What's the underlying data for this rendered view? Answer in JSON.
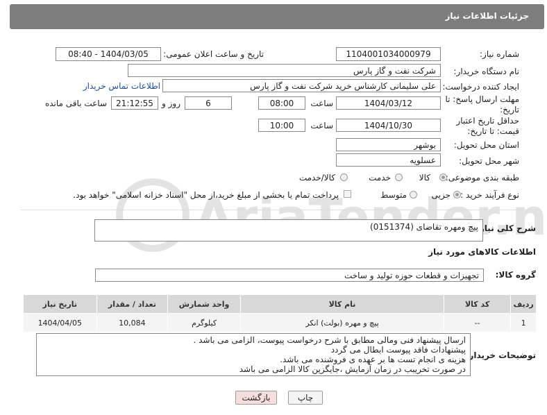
{
  "header": {
    "title": "جزئیات اطلاعات نیاز"
  },
  "fields": {
    "need_number_label": "شماره نیاز:",
    "need_number": "1104001034000979",
    "announce_label": "تاریخ و ساعت اعلان عمومی:",
    "announce_value": "1404/03/05 - 08:40",
    "buyer_org_label": "نام دستگاه خریدار:",
    "buyer_org": "شرکت نفت و گاز پارس",
    "requester_label": "ایجاد کننده درخواست:",
    "requester": "علی سلیمانی کارشناس خرید شرکت نفت و گاز پارس",
    "contact_link": "اطلاعات تماس خریدار",
    "deadline_label": "مهلت ارسال پاسخ: تا تاریخ:",
    "deadline_date": "1404/03/12",
    "time_label": "ساعت",
    "deadline_time": "08:00",
    "days_value": "6",
    "days_label": "روز و",
    "remaining_time": "21:12:55",
    "remaining_label": "ساعت باقی مانده",
    "validity_label": "حداقل تاریخ اعتبار قیمت: تا تاریخ:",
    "validity_date": "1404/10/30",
    "validity_time": "10:00",
    "province_label": "استان محل تحویل:",
    "province": "بوشهر",
    "city_label": "شهر محل تحویل:",
    "city": "عسلویه",
    "category_label": "طبقه بندی موضوعی:",
    "category_options": [
      "کالا",
      "خدمت",
      "کالا/خدمت"
    ],
    "process_label": "نوع فرآیند خرید :",
    "process_options": [
      "جزیی",
      "متوسط"
    ],
    "payment_note": "پرداخت تمام یا بخشی از مبلغ خرید،از محل \"اسناد خزانه اسلامی\" خواهد بود."
  },
  "description": {
    "label": "شرح کلی نیاز:",
    "value": "پیچ ومهره تقاضای (0151374)"
  },
  "goods_section": {
    "title": "اطلاعات کالاهای مورد نیاز",
    "group_label": "گروه کالا:",
    "group_value": "تجهیزات و قطعات حوزه تولید و ساخت"
  },
  "table": {
    "headers": [
      "ردیف",
      "کد کالا",
      "نام کالا",
      "واحد شمارش",
      "تعداد / مقدار",
      "تاریخ نیاز"
    ],
    "rows": [
      [
        "1",
        "--",
        "پیچ و مهره (بولت) انکر",
        "کیلوگرم",
        "10,084",
        "1404/04/05"
      ]
    ]
  },
  "buyer_notes": {
    "label": "توضیحات خریدار:",
    "lines": [
      "ارسال پیشنهاد فنی ومالی مطابق با شرح درخواست پیوست، الزامی می باشد .",
      "پیشنهادات فاقد پیوست ابطال می گردد",
      "هزینه ی انجام تست ها بر عهده ی فروشنده می باشد.",
      "در صورت تخریبب در زمان آزمایش ،جایگزین کالا الزامی می باشد"
    ]
  },
  "buttons": {
    "print": "چاپ",
    "back": "بازگشت"
  },
  "watermark": {
    "text": "AriaTender.neT"
  },
  "colors": {
    "header_bg": "#7d7d7d",
    "link": "#1a4ea0",
    "back_button_bg": "#f7dede"
  }
}
